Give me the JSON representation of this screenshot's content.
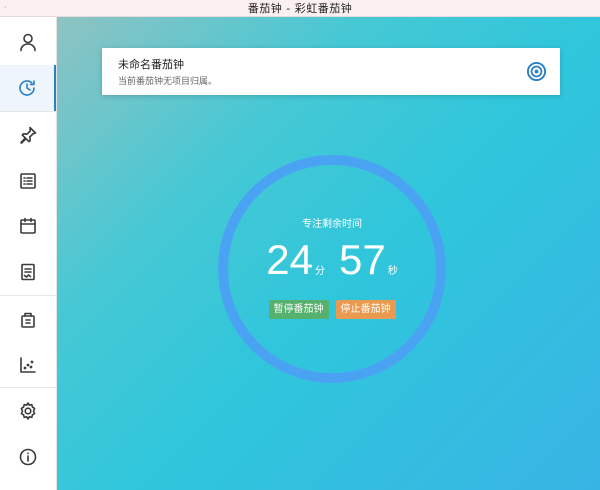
{
  "window": {
    "title": "番茄钟 - 彩虹番茄钟",
    "dot": "·"
  },
  "sidebar": {
    "items": [
      {
        "icon": "user-icon"
      },
      {
        "icon": "clock-icon",
        "active": true
      },
      {
        "icon": "pin-icon"
      },
      {
        "icon": "list-icon"
      },
      {
        "icon": "calendar-icon"
      },
      {
        "icon": "report-icon"
      },
      {
        "icon": "package-icon"
      },
      {
        "icon": "scatter-chart-icon"
      },
      {
        "icon": "gear-icon"
      },
      {
        "icon": "info-icon"
      }
    ]
  },
  "task_card": {
    "name": "未命名番茄钟",
    "subtitle": "当前番茄钟无项目归属。",
    "action_icon": "target-icon"
  },
  "timer": {
    "label": "专注剩余时间",
    "minutes": "24",
    "minutes_unit": "分",
    "seconds": "57",
    "seconds_unit": "秒",
    "progress": 1.0
  },
  "buttons": {
    "pause": "暂停番茄钟",
    "stop": "停止番茄钟"
  },
  "colors": {
    "accent": "#2a80c6",
    "ring": "#4aa3f2",
    "pause_button": "#56b06e",
    "stop_button": "#e99a50"
  }
}
